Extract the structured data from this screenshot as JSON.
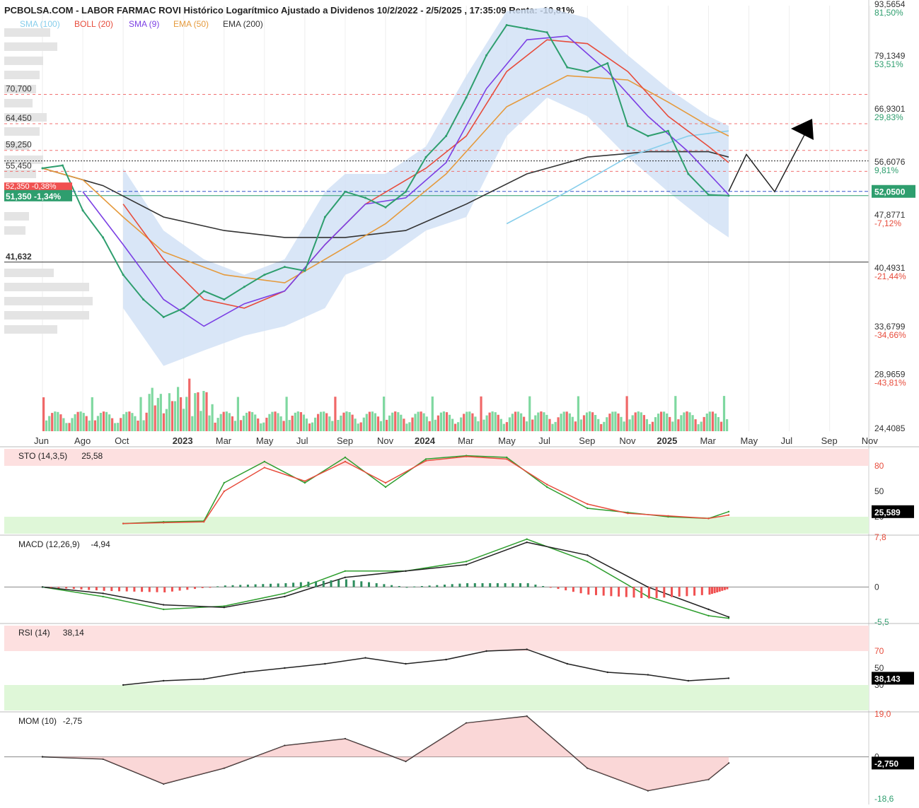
{
  "header": {
    "title": "PCBOLSA.COM - LABOR FARMAC ROVI Histórico Logarítmico Ajustado a Dividenos 10/2/2022 - 2/5/2025 , 17:35:09 Renta: -10,81%"
  },
  "legend": [
    {
      "label": "SMA (100)",
      "color": "#87ceeb"
    },
    {
      "label": "BOLL (20)",
      "color": "#e74c3c"
    },
    {
      "label": "SMA (9)",
      "color": "#7b3fe4"
    },
    {
      "label": "EMA (50)",
      "color": "#e59a3c"
    },
    {
      "label": "EMA (200)",
      "color": "#333333"
    }
  ],
  "colors": {
    "price": "#2e9e6e",
    "price_down": "#f05050",
    "boll_band": "#cfe0f5",
    "vol_up": "#7fd8a0",
    "vol_down": "#f06868",
    "sto_main": "#2e9e2e",
    "sto_signal": "#e74c3c",
    "overbought": "#fde0e0",
    "oversold": "#dff7d8"
  },
  "chart_data": [
    {
      "type": "line",
      "name": "price",
      "scale": "log",
      "ylim": [
        24.4085,
        93.5654
      ],
      "x": [
        "2022-06",
        "2022-07",
        "2022-08",
        "2022-09",
        "2022-10",
        "2022-11",
        "2022-12",
        "2023-01",
        "2023-02",
        "2023-03",
        "2023-04",
        "2023-05",
        "2023-06",
        "2023-07",
        "2023-08",
        "2023-09",
        "2023-10",
        "2023-11",
        "2023-12",
        "2024-01",
        "2024-02",
        "2024-03",
        "2024-04",
        "2024-05",
        "2024-06",
        "2024-07",
        "2024-08",
        "2024-09",
        "2024-10",
        "2024-11",
        "2024-12",
        "2025-01",
        "2025-02",
        "2025-03",
        "2025-04"
      ],
      "y": [
        56.0,
        56.5,
        49.0,
        45.0,
        40.0,
        37.0,
        35.0,
        36.0,
        38.0,
        37.0,
        38.5,
        40.0,
        41.0,
        40.5,
        48.0,
        52.0,
        51.0,
        49.5,
        52.0,
        58.0,
        62.0,
        70.0,
        80.0,
        88.0,
        87.0,
        86.0,
        77.0,
        76.0,
        78.0,
        64.0,
        62.0,
        63.0,
        55.0,
        51.5,
        51.35
      ],
      "x_tick_labels": [
        "Jun",
        "Ago",
        "Oct",
        "2023",
        "Mar",
        "May",
        "Jul",
        "Sep",
        "Nov",
        "2024",
        "Mar",
        "May",
        "Jul",
        "Sep",
        "Nov",
        "2025",
        "Mar",
        "May",
        "Jul",
        "Sep",
        "Nov"
      ],
      "y_tick_labels": [
        {
          "value": "93,5654",
          "pct": "81,50%",
          "pct_color": "green"
        },
        {
          "value": "79,1349",
          "pct": "53,51%",
          "pct_color": "green"
        },
        {
          "value": "66,9301",
          "pct": "29,83%",
          "pct_color": "green"
        },
        {
          "value": "56,6076",
          "pct": "9,81%",
          "pct_color": "green"
        },
        {
          "value": "52,0500",
          "pct": "",
          "pct_color": "box"
        },
        {
          "value": "47,8771",
          "pct": "-7,12%",
          "pct_color": "red"
        },
        {
          "value": "40,4931",
          "pct": "-21,44%",
          "pct_color": "red"
        },
        {
          "value": "33,6799",
          "pct": "-34,66%",
          "pct_color": "red"
        },
        {
          "value": "28,9659",
          "pct": "-43,81%",
          "pct_color": "red"
        },
        {
          "value": "24,4085",
          "pct": "",
          "pct_color": "none"
        }
      ],
      "levels": [
        {
          "label": "70,700",
          "value": 70.7,
          "style": "red-dashed"
        },
        {
          "label": "64,450",
          "value": 64.45,
          "style": "red-dashed"
        },
        {
          "label": "59,250",
          "value": 59.25,
          "style": "red-dashed"
        },
        {
          "label": "55,450",
          "value": 55.45,
          "style": "red-dashed"
        },
        {
          "label": "41,632",
          "value": 41.632,
          "style": "black"
        }
      ],
      "last_price_label": "51,350 -1,34%",
      "prev_label": "52,350 -0,38%",
      "current_box": "52,0500"
    },
    {
      "type": "line",
      "name": "STO (14,3,5)",
      "title": "STO (14,3,5)",
      "current": "25,58",
      "current_box": "25,589",
      "ylim": [
        0,
        100
      ],
      "y_tick_labels": [
        "80",
        "50",
        "20"
      ],
      "x": [
        "2022-10",
        "2022-12",
        "2023-02",
        "2023-03",
        "2023-05",
        "2023-07",
        "2023-09",
        "2023-11",
        "2024-01",
        "2024-03",
        "2024-05",
        "2024-07",
        "2024-09",
        "2024-11",
        "2025-01",
        "2025-03",
        "2025-04"
      ],
      "series": [
        {
          "values": [
            12,
            14,
            15,
            60,
            85,
            60,
            90,
            55,
            88,
            92,
            90,
            55,
            30,
            25,
            20,
            18,
            26
          ]
        },
        {
          "values": [
            12,
            13,
            14,
            50,
            78,
            62,
            85,
            60,
            86,
            91,
            88,
            58,
            35,
            24,
            21,
            18,
            22
          ]
        }
      ]
    },
    {
      "type": "line",
      "name": "MACD (12,26,9)",
      "title": "MACD (12,26,9)",
      "current": "-4,94",
      "ylim": [
        -5.5,
        7.8
      ],
      "y_tick_labels": [
        "7,8",
        "0",
        "-5,5"
      ],
      "x": [
        "2022-06",
        "2022-09",
        "2022-12",
        "2023-03",
        "2023-06",
        "2023-09",
        "2023-12",
        "2024-03",
        "2024-06",
        "2024-09",
        "2024-12",
        "2025-03",
        "2025-04"
      ],
      "series": [
        {
          "values": [
            0,
            -1.5,
            -3.5,
            -3.0,
            -1.0,
            2.5,
            2.5,
            4.0,
            7.5,
            4.0,
            -1.5,
            -4.5,
            -4.9
          ]
        },
        {
          "values": [
            0,
            -1.0,
            -2.8,
            -3.2,
            -1.5,
            1.5,
            2.5,
            3.5,
            7.0,
            5.0,
            0,
            -3.5,
            -4.7
          ]
        }
      ]
    },
    {
      "type": "line",
      "name": "RSI (14)",
      "title": "RSI (14)",
      "current": "38,14",
      "current_box": "38,143",
      "ylim": [
        0,
        100
      ],
      "y_tick_labels": [
        "70",
        "50",
        "30"
      ],
      "x": [
        "2022-10",
        "2022-12",
        "2023-02",
        "2023-04",
        "2023-06",
        "2023-08",
        "2023-10",
        "2023-12",
        "2024-02",
        "2024-04",
        "2024-06",
        "2024-08",
        "2024-10",
        "2024-12",
        "2025-02",
        "2025-04"
      ],
      "series": [
        {
          "values": [
            30,
            35,
            37,
            45,
            50,
            55,
            62,
            55,
            60,
            70,
            72,
            55,
            45,
            42,
            35,
            38
          ]
        }
      ]
    },
    {
      "type": "line",
      "name": "MOM (10)",
      "title": "MOM (10)",
      "current": "-2,75",
      "current_box": "-2,750",
      "ylim": [
        -18.6,
        19.0
      ],
      "y_tick_labels": [
        "19,0",
        "0",
        "-18,6"
      ],
      "x": [
        "2022-06",
        "2022-09",
        "2022-12",
        "2023-03",
        "2023-06",
        "2023-09",
        "2023-12",
        "2024-03",
        "2024-06",
        "2024-09",
        "2024-12",
        "2025-03",
        "2025-04"
      ],
      "series": [
        {
          "values": [
            0,
            -1,
            -12,
            -5,
            5,
            8,
            -2,
            15,
            18,
            -5,
            -15,
            -10,
            -2.75
          ]
        }
      ]
    }
  ]
}
